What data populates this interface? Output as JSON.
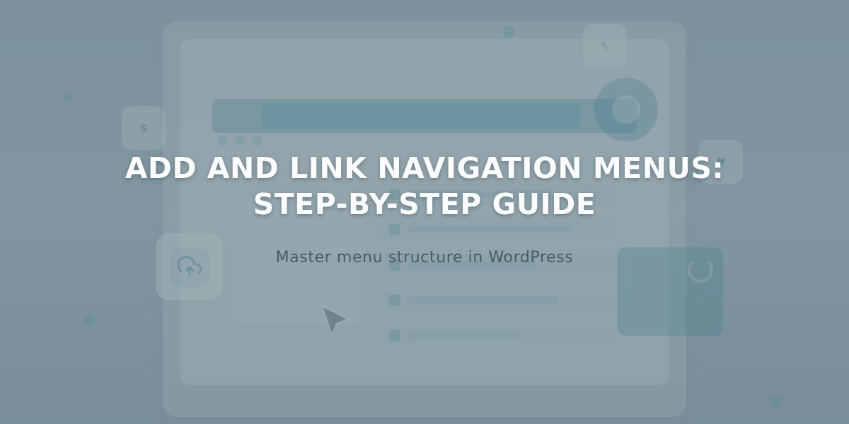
{
  "hero": {
    "title_line1": "ADD AND LINK NAVIGATION MENUS:",
    "title_line2": "STEP-BY-STEP GUIDE",
    "subtitle": "Master menu structure in WordPress"
  },
  "bg_badges": {
    "badge1_glyph": "✎",
    "badge2_glyph": "$",
    "badge3_glyph": "♥"
  }
}
